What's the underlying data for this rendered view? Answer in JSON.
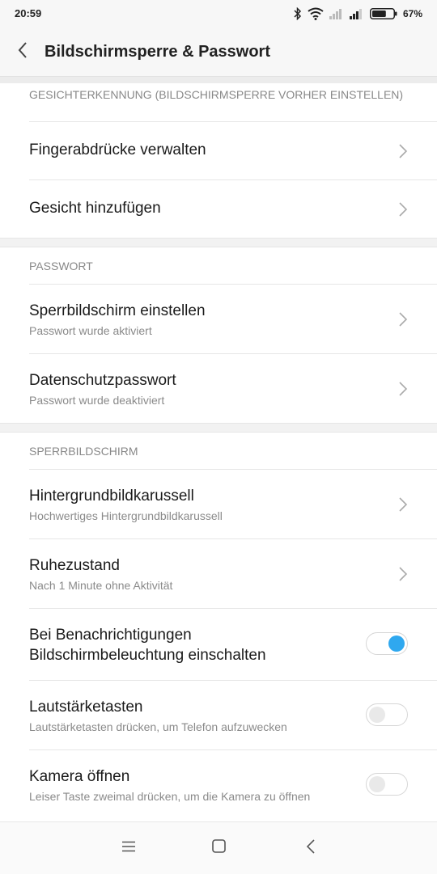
{
  "status_bar": {
    "time": "20:59",
    "battery_percent": "67%",
    "battery_level": 0.67,
    "icons": [
      "bluetooth-icon",
      "wifi-icon",
      "signal-icon",
      "signal-icon",
      "battery-icon"
    ]
  },
  "header": {
    "title": "Bildschirmsperre & Passwort",
    "back_icon": "back-arrow-icon"
  },
  "sections": {
    "face": {
      "header": "GESICHTERKENNUNG (BILDSCHIRMSPERRE VORHER EINSTELLEN)",
      "items": [
        {
          "title": "Fingerabdrücke verwalten"
        },
        {
          "title": "Gesicht hinzufügen"
        }
      ]
    },
    "password": {
      "header": "PASSWORT",
      "items": [
        {
          "title": "Sperrbildschirm einstellen",
          "subtitle": "Passwort wurde aktiviert"
        },
        {
          "title": "Datenschutzpasswort",
          "subtitle": "Passwort wurde deaktiviert"
        }
      ]
    },
    "lockscreen": {
      "header": "SPERRBILDSCHIRM",
      "items": [
        {
          "title": "Hintergrundbildkarussell",
          "subtitle": "Hochwertiges Hintergrundbildkarussell"
        },
        {
          "title": "Ruhezustand",
          "subtitle": "Nach 1 Minute ohne Aktivität"
        },
        {
          "title_line1": "Bei Benachrichtigungen",
          "title_line2": "Bildschirmbeleuchtung einschalten",
          "toggle": true
        },
        {
          "title": "Lautstärketasten",
          "subtitle": "Lautstärketasten drücken, um Telefon aufzuwecken",
          "toggle": false
        },
        {
          "title": "Kamera öffnen",
          "subtitle": "Leiser Taste zweimal drücken, um die Kamera zu öffnen",
          "toggle": false
        }
      ]
    }
  },
  "nav_bar": {
    "icons": [
      "menu-icon",
      "home-icon",
      "back-icon"
    ]
  },
  "colors": {
    "accent": "#2fa8ef",
    "background": "#ffffff",
    "section_header": "#888888"
  }
}
